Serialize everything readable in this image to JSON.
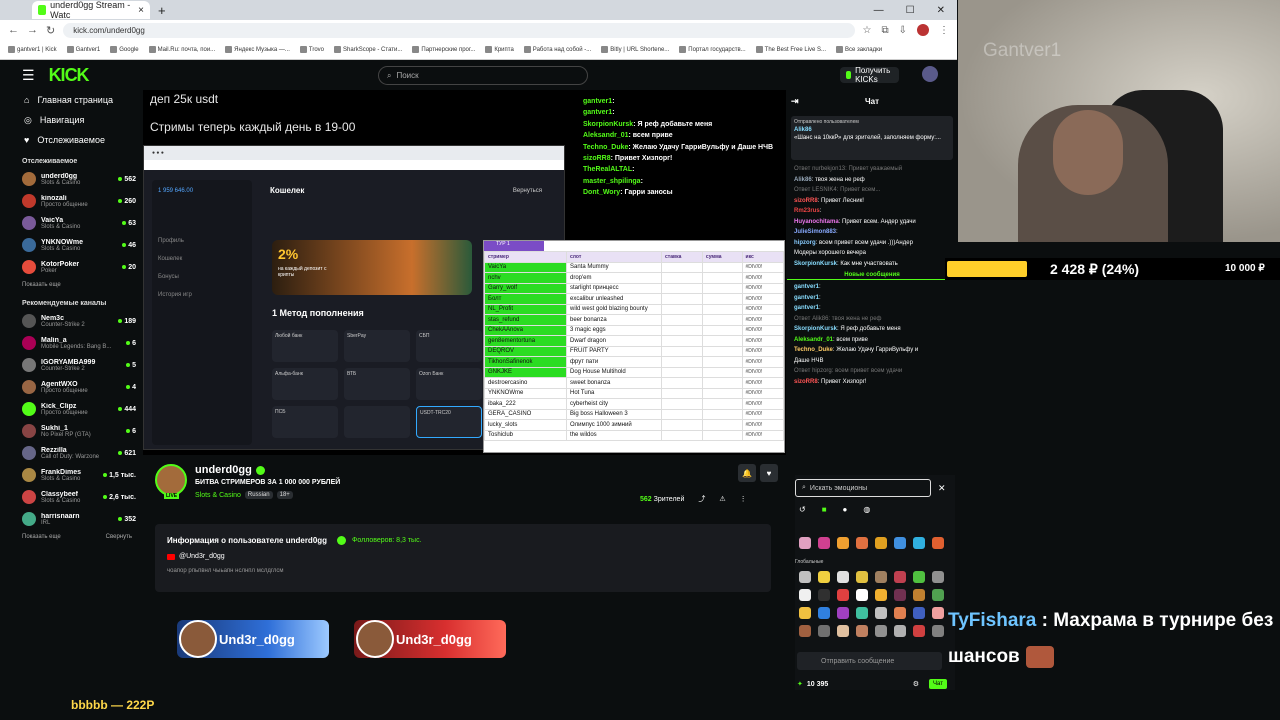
{
  "browser": {
    "tab_title": "underd0gg Stream - Watc",
    "url": "kick.com/underd0gg",
    "bookmarks": [
      "gantver1 | Kick",
      "Gantver1",
      "Google",
      "Mail.Ru: почта, пои...",
      "Яндекс Музыка —...",
      "Trovo",
      "SharkScope - Стати...",
      "Партнерские прог...",
      "Крипта",
      "Работа над собой -...",
      "Bitly | URL Shortene...",
      "Портал государств...",
      "The Best Free Live S...",
      "Все закладки"
    ]
  },
  "kick": {
    "logo": "KICK",
    "search_placeholder": "Поиск",
    "get_kicks": "Получить KICKs",
    "menu": [
      "Главная страница",
      "Навигация",
      "Отслеживаемое"
    ],
    "followed_title": "Отслеживаемое",
    "followed": [
      {
        "name": "underd0gg",
        "cat": "Slots & Casino",
        "viewers": "562",
        "color": "#a36b3b"
      },
      {
        "name": "kinozali",
        "cat": "Просто общение",
        "viewers": "260",
        "color": "#c0392b"
      },
      {
        "name": "VaicYa",
        "cat": "Slots & Casino",
        "viewers": "63",
        "color": "#7a5a9a"
      },
      {
        "name": "YNKNOWme",
        "cat": "Slots & Casino",
        "viewers": "46",
        "color": "#3a6a9a"
      },
      {
        "name": "KotorPoker",
        "cat": "Poker",
        "viewers": "20",
        "color": "#e74c3c"
      }
    ],
    "show_more": "Показать еще",
    "recommended_title": "Рекомендуемые каналы",
    "recommended": [
      {
        "name": "Nem3c",
        "cat": "Counter-Strike 2",
        "viewers": "189",
        "color": "#555"
      },
      {
        "name": "Malin_a",
        "cat": "Mobile Legends: Bang B...",
        "viewers": "6",
        "color": "#a05"
      },
      {
        "name": "IGORYAMBA999",
        "cat": "Counter-Strike 2",
        "viewers": "5",
        "color": "#777"
      },
      {
        "name": "AgentWXO",
        "cat": "Просто общение",
        "viewers": "4",
        "color": "#964"
      },
      {
        "name": "Kick_Clipz",
        "cat": "Просто общение",
        "viewers": "444",
        "color": "#53fc18"
      },
      {
        "name": "Sukhi_1",
        "cat": "No Pixel RP (GTA)",
        "viewers": "6",
        "color": "#844"
      },
      {
        "name": "Rezzilla",
        "cat": "Call of Duty: Warzone",
        "viewers": "621",
        "color": "#668"
      },
      {
        "name": "FrankDimes",
        "cat": "Slots & Casino",
        "viewers": "1,5 тыс.",
        "color": "#a84"
      },
      {
        "name": "Classybeef",
        "cat": "Slots & Casino",
        "viewers": "2,6 тыс.",
        "color": "#c44"
      },
      {
        "name": "harrisnaarn",
        "cat": "IRL",
        "viewers": "352",
        "color": "#4a8"
      }
    ],
    "show_more2": "Показать еще",
    "collapse": "Свернуть"
  },
  "player": {
    "line1": "деп 25к  usdt",
    "line2": "Стримы теперь каждый день в 19-00",
    "casino": {
      "wallet": "Кошелек",
      "back": "Вернуться",
      "promo_pct": "2%",
      "promo_text": "на каждый депозит с крипты",
      "method": "1  Метод пополнения",
      "menu": [
        "Профиль",
        "Кошелек",
        "Бонусы",
        "История игр"
      ],
      "balance": "1 959 646.00",
      "pays": [
        "Любой банк",
        "SberPay",
        "СБП",
        "",
        "Альфа-банк",
        "ВТБ",
        "Ozon Банк",
        "",
        "ПСБ",
        "",
        "USDT-TRC20",
        "USDT"
      ]
    },
    "sheet": {
      "tab": "ТУР 1",
      "headers": [
        "стример",
        "слот",
        "ставка",
        "сумма",
        "икс"
      ],
      "rows": [
        [
          "VaicYa",
          "Santa Mummy",
          "#DIV/0!",
          true
        ],
        [
          "nchv",
          "drop'em",
          "#DIV/0!",
          true
        ],
        [
          "Garry_wolf",
          "starlight принцесс",
          "#DIV/0!",
          true
        ],
        [
          "Болт",
          "excalibur unleashed",
          "#DIV/0!",
          true
        ],
        [
          "NL_Profit",
          "wild west gold blazing bounty",
          "#DIV/0!",
          true
        ],
        [
          "stas_refund",
          "beer bonanza",
          "#DIV/0!",
          true
        ],
        [
          "ChekAAnova",
          "3 magic eggs",
          "#DIV/0!",
          true
        ],
        [
          "gen8ementortuna",
          "Dwarf dragon",
          "#DIV/0!",
          true
        ],
        [
          "DEQROV",
          "FRUIT PARTY",
          "#DIV/0!",
          true
        ],
        [
          "TikhonSafinenok",
          "фрут пати",
          "#DIV/0!",
          true
        ],
        [
          "GNKJKE",
          "Dog House Multihold",
          "#DIV/0!",
          true
        ],
        [
          "destroercasino",
          "sweet bonanza",
          "#DIV/0!",
          false
        ],
        [
          "YNKNOWme",
          "Hot Tuna",
          "#DIV/0!",
          false
        ],
        [
          "ibaka_222",
          "cyberheist city",
          "#DIV/0!",
          false
        ],
        [
          "GERA_CASINO",
          "Big boss Halloween 3",
          "#DIV/0!",
          false
        ],
        [
          "lucky_slots",
          "Олимпус 1000 зимний",
          "#DIV/0!",
          false
        ],
        [
          "Toshiclub",
          "the wildos",
          "#DIV/0!",
          false
        ]
      ]
    },
    "overlay_chat": [
      [
        "gantver1",
        ": "
      ],
      [
        "gantver1",
        ": "
      ],
      [
        "SkorpionKursk",
        ": Я реф добавьте меня"
      ],
      [
        "Aleksandr_01",
        ": всем приве"
      ],
      [
        "Techno_Duke",
        ": Желаю Удачу ГарриВульфу и Даше НЧВ"
      ],
      [
        "sizoRR8",
        ": Привет Хизпорг!"
      ],
      [
        "TheRealALTAL",
        ": "
      ],
      [
        "master_shpilinga",
        ": "
      ],
      [
        "Dont_Wory",
        ": Гарри заносы"
      ]
    ]
  },
  "stream": {
    "name": "underd0gg",
    "title": "БИТВА СТРИМЕРОВ ЗА 1 000 000 РУБЛЕЙ",
    "category": "Slots & Casino",
    "tags": [
      "Russian",
      "18+"
    ],
    "viewers": "562",
    "viewers_label": "Зрителей",
    "live": "LIVE"
  },
  "about": {
    "heading": "Информация о пользователе underd0gg",
    "followers": "Фолловеров: 8,3 тыс.",
    "youtube": "@Und3r_d0gg",
    "bio": "чоапор рпьпвнл чыьапн нслнпл мслдглсм"
  },
  "banners": [
    "Und3r_d0gg",
    "Und3r_d0gg"
  ],
  "ticker": "bbbbb — 222P",
  "chat": {
    "title": "Чат",
    "pinned_label": "Отправлено пользователем",
    "pinned_user": "Alik86",
    "pinned_text": "«Шанс на 10ккР» для зрителей, заполняем форму:...",
    "messages": [
      {
        "u": "",
        "t": "Ответ nurbekjon13: Привет уважаемый",
        "c": "#777",
        "reply": true
      },
      {
        "u": "Alik86",
        "t": ": твоя жена не реф",
        "c": "#9ab"
      },
      {
        "u": "",
        "t": "Ответ LESNIK4: Привет всем...",
        "c": "#777",
        "reply": true
      },
      {
        "u": "sizoRR8",
        "t": ": Привет Лесник!",
        "c": "#f55"
      },
      {
        "u": "Rm23rus",
        "t": ": ",
        "c": "#e44"
      },
      {
        "u": "Huyanochitama",
        "t": ": Привет всем. Андер удачи",
        "c": "#e7e"
      },
      {
        "u": "",
        "t": "",
        "c": "#777"
      },
      {
        "u": "JulieSimon883",
        "t": ": ",
        "c": "#8af"
      },
      {
        "u": "hipzorg",
        "t": ": всем привет всем удачи .)))Андер",
        "c": "#8cf"
      },
      {
        "u": "",
        "t": "Модеры хорошего вечера",
        "c": "#fff"
      },
      {
        "u": "SkorpionKursk",
        "t": ": Как мне участвовать",
        "c": "#8df"
      }
    ],
    "new_messages": "Новые сообщения",
    "messages2": [
      {
        "u": "gantver1",
        "t": ": ",
        "c": "#8df"
      },
      {
        "u": "gantver1",
        "t": ": ",
        "c": "#8df"
      },
      {
        "u": "gantver1",
        "t": ": ",
        "c": "#8df"
      },
      {
        "u": "",
        "t": "Ответ Alik86: твоя жена не реф",
        "c": "#777"
      },
      {
        "u": "SkorpionKursk",
        "t": ": Я реф добавьте меня",
        "c": "#8df"
      },
      {
        "u": "Aleksandr_01",
        "t": ": всем приве",
        "c": "#53fc18"
      },
      {
        "u": "Techno_Duke",
        "t": ": Желаю Удачу ГарриВульфу и",
        "c": "#fc6"
      },
      {
        "u": "",
        "t": "Даше НЧВ",
        "c": "#fff"
      },
      {
        "u": "",
        "t": "Ответ hipzorg: всем привет всем удачи",
        "c": "#777"
      },
      {
        "u": "sizoRR8",
        "t": ": Привет Хизпорг!",
        "c": "#f55"
      }
    ],
    "emoji_search": "Искать эмоционы",
    "emoji_global": "Глобальные",
    "send_placeholder": "Отправить сообщение",
    "points": "10 395",
    "chat_button": "Чат"
  },
  "cam": {
    "watermark": "Gantver1"
  },
  "goal": {
    "current": "2 428 ₽ (24%)",
    "target": "10 000 ₽",
    "progress": 0.24
  },
  "alert": {
    "name": "TyFishara",
    "text": " : Махрама в турнире без шансов"
  }
}
